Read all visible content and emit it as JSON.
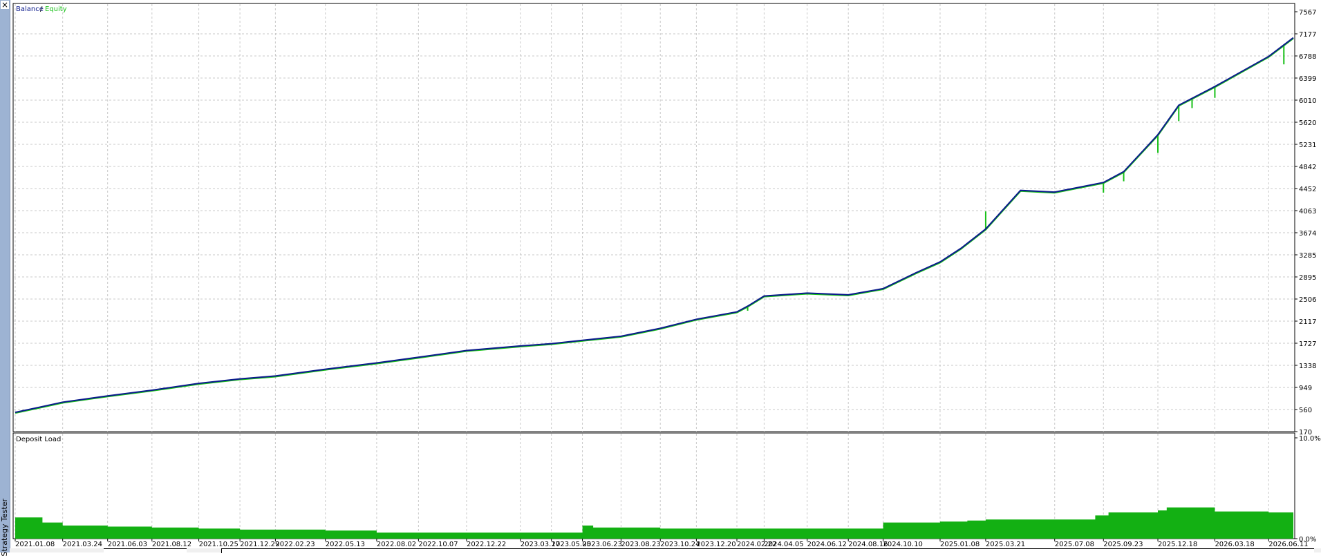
{
  "window": {
    "vertical_title": "Strategy Tester",
    "close_glyph": "×"
  },
  "colors": {
    "balance": "#0b1a8c",
    "equity": "#18c018",
    "deposit_fill": "#13b013",
    "grid": "#c8c8c8",
    "border": "#000000"
  },
  "chart_data": [
    {
      "type": "line",
      "legend": {
        "balance": "Balance",
        "separator": " / ",
        "equity": "Equity",
        "placement": "top-left"
      },
      "series": [
        {
          "name": "Balance",
          "x": [
            "2021.01.08",
            "2021.02.15",
            "2021.03.24",
            "2021.06.03",
            "2021.08.12",
            "2021.10.25",
            "2021.12.29",
            "2022.02.23",
            "2022.05.13",
            "2022.08.02",
            "2022.10.07",
            "2022.12.22",
            "2023.03.17",
            "2023.05.05",
            "2023.06.23",
            "2023.08.23",
            "2023.10.24",
            "2023.12.20",
            "2024.02.22",
            "2024.03.10",
            "2024.04.05",
            "2024.06.12",
            "2024.08.16",
            "2024.10.10",
            "2024.12.01",
            "2025.01.08",
            "2025.02.10",
            "2025.03.21",
            "2025.05.15",
            "2025.07.08",
            "2025.09.23",
            "2025.10.25",
            "2025.12.18",
            "2026.01.20",
            "2026.03.18",
            "2026.06.11",
            "2026.07.20"
          ],
          "values": [
            510,
            600,
            690,
            800,
            900,
            1020,
            1100,
            1150,
            1270,
            1380,
            1480,
            1600,
            1680,
            1720,
            1780,
            1850,
            1990,
            2150,
            2280,
            2380,
            2560,
            2610,
            2580,
            2690,
            2970,
            3160,
            3400,
            3740,
            4420,
            4390,
            4560,
            4750,
            5400,
            5920,
            6250,
            6780,
            7110
          ]
        },
        {
          "name": "Equity",
          "x": [
            "2021.01.08",
            "2021.02.15",
            "2021.03.24",
            "2021.06.03",
            "2021.08.12",
            "2021.10.25",
            "2021.12.29",
            "2022.02.23",
            "2022.05.13",
            "2022.08.02",
            "2022.10.07",
            "2022.12.22",
            "2023.03.17",
            "2023.05.05",
            "2023.06.23",
            "2023.08.23",
            "2023.10.24",
            "2023.12.20",
            "2024.02.22",
            "2024.03.10",
            "2024.04.05",
            "2024.06.12",
            "2024.08.16",
            "2024.10.10",
            "2024.12.01",
            "2025.01.08",
            "2025.02.10",
            "2025.03.21",
            "2025.05.15",
            "2025.07.08",
            "2025.09.23",
            "2025.10.25",
            "2025.12.18",
            "2026.01.20",
            "2026.03.18",
            "2026.06.11",
            "2026.07.20"
          ],
          "values": [
            500,
            590,
            680,
            790,
            890,
            1010,
            1090,
            1140,
            1260,
            1370,
            1470,
            1590,
            1670,
            1710,
            1770,
            1840,
            1980,
            2140,
            2270,
            2370,
            2550,
            2600,
            2570,
            2680,
            2960,
            3150,
            3390,
            3730,
            4410,
            4380,
            4550,
            4740,
            5390,
            5910,
            6240,
            6770,
            7100
          ],
          "drawdown_spikes": [
            {
              "x": "2024.03.10",
              "low": 2300
            },
            {
              "x": "2025.03.21",
              "low": 4050
            },
            {
              "x": "2025.09.23",
              "low": 4380
            },
            {
              "x": "2025.10.25",
              "low": 4580
            },
            {
              "x": "2025.12.18",
              "low": 5080
            },
            {
              "x": "2026.01.20",
              "low": 5640
            },
            {
              "x": "2026.02.10",
              "low": 5870
            },
            {
              "x": "2026.03.18",
              "low": 6050
            },
            {
              "x": "2026.07.05",
              "low": 6640
            }
          ]
        }
      ],
      "yticks": [
        "7567",
        "7177",
        "6788",
        "6399",
        "6010",
        "5620",
        "5231",
        "4842",
        "4452",
        "4063",
        "3674",
        "3285",
        "2895",
        "2506",
        "2117",
        "1727",
        "1338",
        "949",
        "560",
        "170"
      ],
      "ylim": [
        170,
        7567
      ],
      "grid": true
    },
    {
      "type": "area",
      "title": "Deposit Load",
      "unit": "%",
      "yticks": [
        "10.0%",
        "0.0%"
      ],
      "ylim": [
        0,
        10
      ],
      "x": [
        "2021.01.08",
        "2021.02.20",
        "2021.03.24",
        "2021.06.03",
        "2021.08.12",
        "2021.10.25",
        "2021.12.29",
        "2022.02.23",
        "2022.05.13",
        "2022.08.02",
        "2022.10.07",
        "2022.12.22",
        "2023.03.17",
        "2023.05.05",
        "2023.06.15",
        "2023.06.23",
        "2023.07.10",
        "2023.08.23",
        "2023.10.24",
        "2023.12.20",
        "2024.02.22",
        "2024.04.05",
        "2024.06.12",
        "2024.08.16",
        "2024.10.10",
        "2025.01.08",
        "2025.02.20",
        "2025.03.21",
        "2025.07.08",
        "2025.09.10",
        "2025.10.01",
        "2025.12.18",
        "2026.01.01",
        "2026.03.18",
        "2026.06.11",
        "2026.07.20"
      ],
      "values": [
        2.1,
        1.6,
        1.3,
        1.2,
        1.1,
        1.0,
        0.9,
        0.9,
        0.8,
        0.6,
        0.6,
        0.6,
        0.6,
        0.6,
        0.6,
        1.3,
        1.1,
        1.1,
        1.0,
        1.0,
        1.0,
        1.0,
        1.0,
        1.0,
        1.6,
        1.7,
        1.8,
        1.9,
        1.9,
        2.3,
        2.6,
        2.8,
        3.1,
        2.7,
        2.6,
        2.5
      ]
    }
  ],
  "xticks": [
    "2021.01.08",
    "2021.03.24",
    "2021.06.03",
    "2021.08.12",
    "2021.10.25",
    "2021.12.29",
    "2022.02.23",
    "2022.05.13",
    "2022.08.02",
    "2022.10.07",
    "2022.12.22",
    "2023.03.17",
    "2023.05.05",
    "2023.06.23",
    "2023.08.23",
    "2023.10.24",
    "2023.12.20",
    "2024.02.22",
    "2024.04.05",
    "2024.06.12",
    "2024.08.16",
    "2024.10.10",
    "2025.01.08",
    "2025.03.21",
    "2025.07.08",
    "2025.09.23",
    "2025.12.18",
    "2026.03.18",
    "2026.06.11"
  ]
}
